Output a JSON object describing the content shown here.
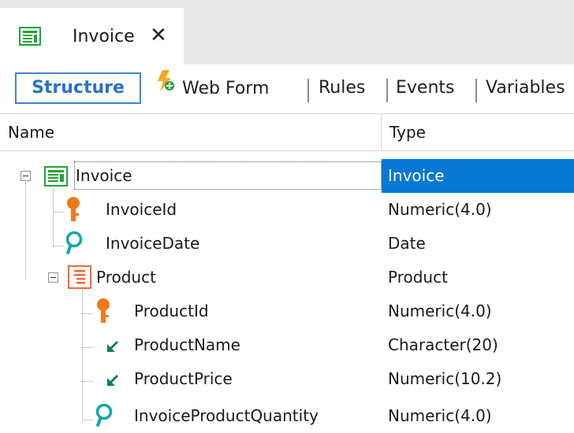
{
  "tab": {
    "title": "Invoice",
    "close": "✕",
    "icon": "transaction-icon"
  },
  "subtabs": {
    "structure": "Structure",
    "webform": "Web Form",
    "rules": "Rules",
    "events": "Events",
    "variables": "Variables"
  },
  "grid": {
    "headers": {
      "name": "Name",
      "type": "Type"
    },
    "rows": [
      {
        "name": "Invoice",
        "type": "Invoice",
        "icon": "transaction-icon",
        "selected": true
      },
      {
        "name": "InvoiceId",
        "type": "Numeric(4.0)",
        "icon": "key-icon"
      },
      {
        "name": "InvoiceDate",
        "type": "Date",
        "icon": "attribute-icon"
      },
      {
        "name": "Product",
        "type": "Product",
        "icon": "level-icon"
      },
      {
        "name": "ProductId",
        "type": "Numeric(4.0)",
        "icon": "key-icon"
      },
      {
        "name": "ProductName",
        "type": "Character(20)",
        "icon": "inferred-icon"
      },
      {
        "name": "ProductPrice",
        "type": "Numeric(10.2)",
        "icon": "inferred-icon"
      },
      {
        "name": "InvoiceProductQuantity",
        "type": "Numeric(4.0)",
        "icon": "attribute-icon"
      }
    ]
  },
  "colors": {
    "selection": "#0878d4",
    "key": "#f07a1a",
    "attribute": "#12a6a6",
    "transaction": "#23a33a",
    "level": "#ef6a3a",
    "active_tab": "#2a73c1"
  }
}
